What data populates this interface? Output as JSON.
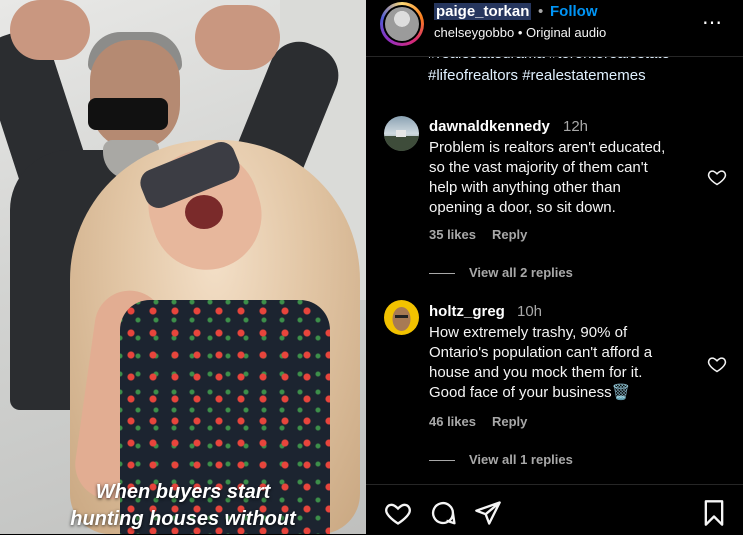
{
  "video": {
    "caption_line1": "When buyers start",
    "caption_line2": "hunting houses without"
  },
  "header": {
    "username": "paige_torkan",
    "separator": "•",
    "follow_label": "Follow",
    "audio_text": "chelseygobbo • Original audio",
    "more_icon": "⋯"
  },
  "post": {
    "hashtags_line1": "#realestatedrama #torontorealestate",
    "hashtags_line2": "#lifeofrealtors #realestatememes"
  },
  "comments": [
    {
      "user": "dawnaldkennedy",
      "time": "12h",
      "lines": [
        "Problem is realtors aren't educated,",
        "so the vast majority of them can't",
        "help with anything other than",
        "opening a door, so sit down."
      ],
      "likes": "35 likes",
      "reply_label": "Reply",
      "replies": "View all 2 replies"
    },
    {
      "user": "holtz_greg",
      "time": "10h",
      "lines": [
        "How extremely trashy, 90% of",
        "Ontario's population can't afford a",
        "house and you mock them for it.",
        "Good face of your business🗑️"
      ],
      "likes": "46 likes",
      "reply_label": "Reply",
      "replies": "View all 1 replies"
    }
  ],
  "actions": {
    "like_icon": "heart-icon",
    "comment_icon": "comment-icon",
    "share_icon": "send-icon",
    "save_icon": "bookmark-icon"
  },
  "colors": {
    "accent": "#0095f6",
    "secondary_text": "#a8a8a8",
    "background": "#000000"
  }
}
